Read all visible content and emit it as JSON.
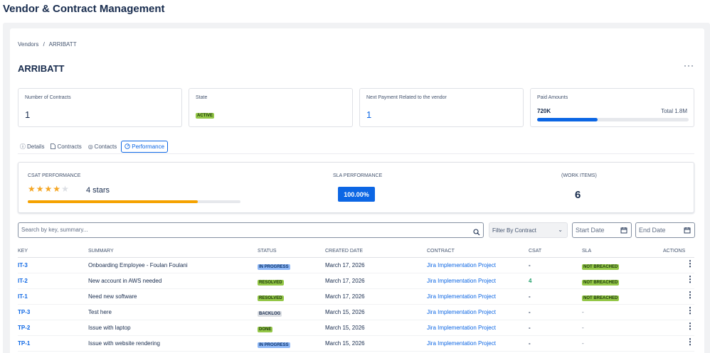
{
  "app": {
    "title": "Vendor & Contract Management"
  },
  "breadcrumb": [
    "Vendors",
    "/",
    "ARRIBATT"
  ],
  "vendor": {
    "name": "ARRIBATT",
    "more_label": "···"
  },
  "summary": {
    "contracts": {
      "label": "Number of Contracts",
      "value": "1"
    },
    "state": {
      "label": "State",
      "value": "ACTIVE"
    },
    "next_payment": {
      "label": "Next Payment Related to the vendor",
      "value": "1"
    },
    "paid": {
      "label": "Paid Amounts",
      "amount": "720K",
      "total": "Total 1.8M",
      "progress_pct": 40
    }
  },
  "tabs": [
    {
      "label": "Details",
      "icon": "info-icon"
    },
    {
      "label": "Contracts",
      "icon": "document-icon"
    },
    {
      "label": "Contacts",
      "icon": "contact-icon"
    },
    {
      "label": "Performance",
      "icon": "performance-icon",
      "active": true
    }
  ],
  "performance": {
    "csat": {
      "label": "CSAT PERFORMANCE",
      "stars_on": 4,
      "stars_total": 5,
      "text": "4 stars",
      "progress_pct": 80
    },
    "sla": {
      "label": "SLA PERFORMANCE",
      "value": "100.00%"
    },
    "work_items": {
      "label": "(WORK ITEMS)",
      "value": "6"
    }
  },
  "filters": {
    "search_placeholder": "Search by key, summary...",
    "contract_filter": "Filter By Contract",
    "start_date": "Start Date",
    "end_date": "End Date"
  },
  "table": {
    "headers": [
      "KEY",
      "SUMMARY",
      "STATUS",
      "CREATED DATE",
      "CONTRACT",
      "CSAT",
      "SLA",
      "ACTIONS"
    ],
    "rows": [
      {
        "key": "IT-3",
        "summary": "Onboarding Employee - Foulan Foulani",
        "status": "IN PROGRESS",
        "status_color": "blue",
        "created": "March 17, 2026",
        "contract": "Jira Implementation Project",
        "csat": "-",
        "sla": "NOT BREACHED"
      },
      {
        "key": "IT-2",
        "summary": "New account in AWS needed",
        "status": "RESOLVED",
        "status_color": "green",
        "created": "March 17, 2026",
        "contract": "Jira Implementation Project",
        "csat": "4",
        "sla": "NOT BREACHED"
      },
      {
        "key": "IT-1",
        "summary": "Need new software",
        "status": "RESOLVED",
        "status_color": "green",
        "created": "March 17, 2026",
        "contract": "Jira Implementation Project",
        "csat": "-",
        "sla": "NOT BREACHED"
      },
      {
        "key": "TP-3",
        "summary": "Test here",
        "status": "BACKLOG",
        "status_color": "gray",
        "created": "March 15, 2026",
        "contract": "Jira Implementation Project",
        "csat": "-",
        "sla": "-"
      },
      {
        "key": "TP-2",
        "summary": "Issue with laptop",
        "status": "DONE",
        "status_color": "green",
        "created": "March 15, 2026",
        "contract": "Jira Implementation Project",
        "csat": "-",
        "sla": "-"
      },
      {
        "key": "TP-1",
        "summary": "Issue with website rendering",
        "status": "IN PROGRESS",
        "status_color": "blue",
        "created": "March 15, 2026",
        "contract": "Jira Implementation Project",
        "csat": "-",
        "sla": "-"
      }
    ],
    "row_action_label": "⋮"
  },
  "colors": {
    "primary": "#0c66e4",
    "star": "#f5a623",
    "success": "#94c748",
    "info": "#8fb8f6"
  }
}
